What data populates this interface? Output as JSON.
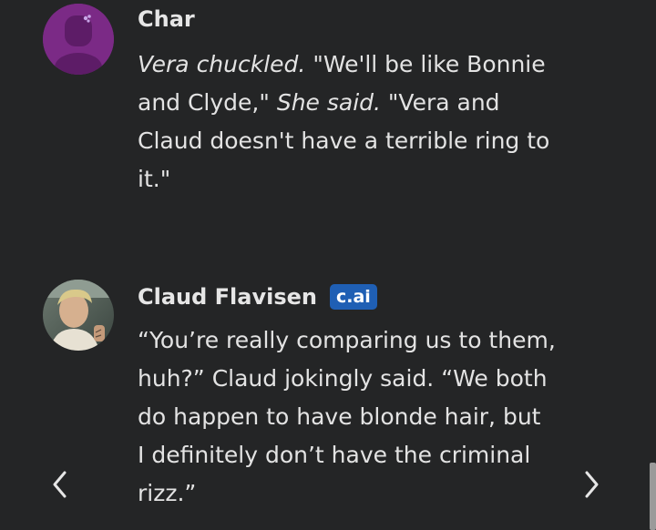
{
  "messages": [
    {
      "sender": "Char",
      "avatar_icon": "user-avatar-purple",
      "body": [
        {
          "text": "Vera chuckled.",
          "italic": true
        },
        {
          "text": " \"We'll be like Bonnie\nand Clyde,\" ",
          "italic": false
        },
        {
          "text": "She said.",
          "italic": true
        },
        {
          "text": " \"Vera and\nClaud doesn't have a terrible ring to\nit.\"",
          "italic": false
        }
      ]
    },
    {
      "sender": "Claud Flavisen",
      "badge": "c.ai",
      "avatar_icon": "character-avatar-photo",
      "body": [
        {
          "text": "“You’re really comparing us to them,\nhuh?” Claud jokingly said. “We both\ndo happen to have blonde hair, but\nI definitely don’t have the criminal\nrizz.”",
          "italic": false
        }
      ]
    }
  ],
  "nav": {
    "prev_icon": "chevron-left-icon",
    "next_icon": "chevron-right-icon"
  },
  "colors": {
    "background": "#242526",
    "text": "#e3e3e3",
    "badge": "#1f5fb4",
    "avatar_purple": "#7b2a86"
  }
}
